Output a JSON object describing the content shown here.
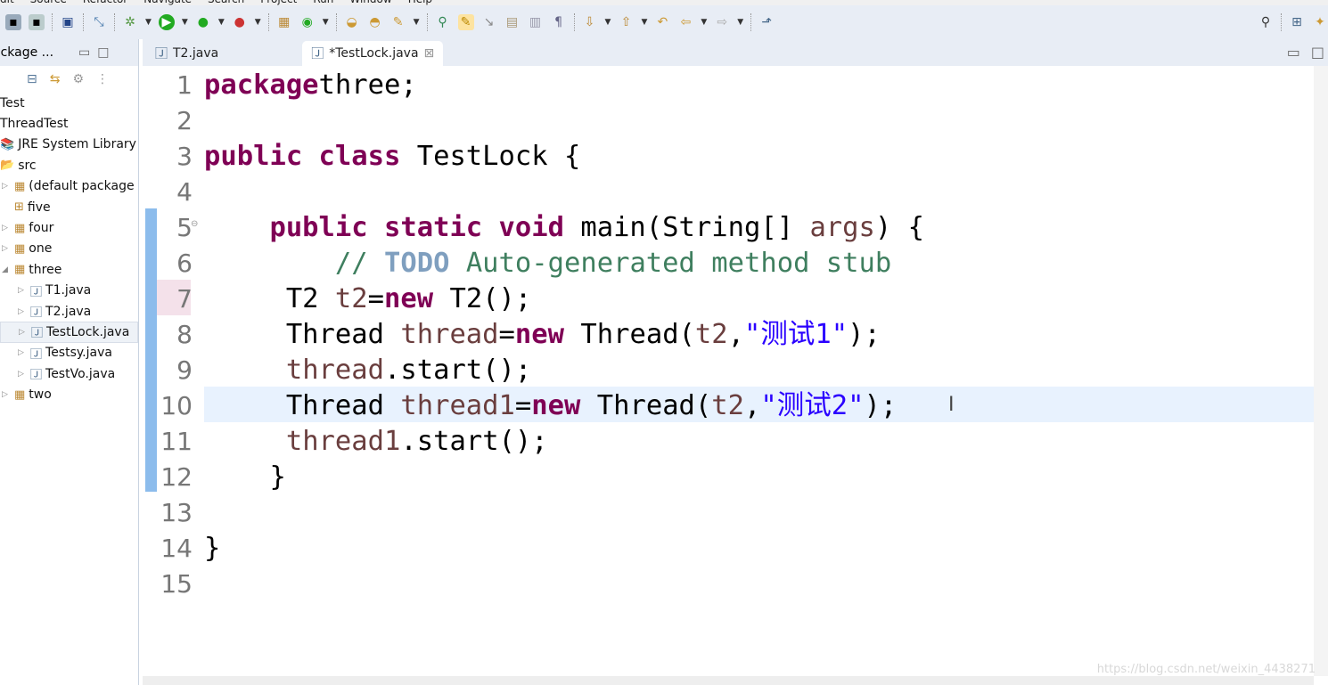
{
  "menu": [
    "dit",
    "Source",
    "Refactor",
    "Navigate",
    "Search",
    "Project",
    "Run",
    "Window",
    "Help"
  ],
  "left_panel": {
    "title": "ackage ...",
    "items": [
      {
        "label": "Test"
      },
      {
        "label": "ThreadTest"
      },
      {
        "label": "JRE System Library"
      },
      {
        "label": "src"
      },
      {
        "label": "(default package"
      },
      {
        "label": "five"
      },
      {
        "label": "four"
      },
      {
        "label": "one"
      },
      {
        "label": "three"
      },
      {
        "label": "T1.java"
      },
      {
        "label": "T2.java"
      },
      {
        "label": "TestLock.java"
      },
      {
        "label": "Testsy.java"
      },
      {
        "label": "TestVo.java"
      },
      {
        "label": "two"
      }
    ]
  },
  "tabs": [
    {
      "label": "T2.java"
    },
    {
      "label": "*TestLock.java"
    }
  ],
  "editor": {
    "line_numbers": [
      "1",
      "2",
      "3",
      "4",
      "5",
      "6",
      "7",
      "8",
      "9",
      "10",
      "11",
      "12",
      "13",
      "14",
      "15"
    ],
    "lines": [
      [
        [
          "kw",
          "package"
        ],
        [
          "",
          "three;"
        ]
      ],
      [],
      [
        [
          "kw",
          "public class"
        ],
        [
          "",
          " TestLock {"
        ]
      ],
      [],
      [
        [
          "",
          "    "
        ],
        [
          "kw",
          "public static void"
        ],
        [
          "",
          " main(String[] "
        ],
        [
          "var",
          "args"
        ],
        [
          "",
          ") {"
        ]
      ],
      [
        [
          "cm",
          "        // "
        ],
        [
          "todo",
          "TODO"
        ],
        [
          "cm",
          " Auto-generated method stub"
        ]
      ],
      [
        [
          "",
          "     T2 "
        ],
        [
          "var",
          "t2"
        ],
        [
          "",
          "="
        ],
        [
          "kw",
          "new"
        ],
        [
          "",
          " T2();"
        ]
      ],
      [
        [
          "",
          "     Thread "
        ],
        [
          "var",
          "thread"
        ],
        [
          "",
          "="
        ],
        [
          "kw",
          "new"
        ],
        [
          "",
          " Thread("
        ],
        [
          "var",
          "t2"
        ],
        [
          "",
          ","
        ],
        [
          "str",
          "\"测试1\""
        ],
        [
          "",
          ");"
        ]
      ],
      [
        [
          "",
          "     "
        ],
        [
          "var",
          "thread"
        ],
        [
          "",
          ".start();"
        ]
      ],
      [
        [
          "",
          "     Thread "
        ],
        [
          "var",
          "thread1"
        ],
        [
          "",
          "="
        ],
        [
          "kw",
          "new"
        ],
        [
          "",
          " Thread("
        ],
        [
          "var",
          "t2"
        ],
        [
          "",
          ","
        ],
        [
          "str",
          "\"测试2\""
        ],
        [
          "",
          ");"
        ]
      ],
      [
        [
          "",
          "     "
        ],
        [
          "var",
          "thread1"
        ],
        [
          "",
          ".start();"
        ]
      ],
      [
        [
          "",
          "    }"
        ]
      ],
      [],
      [
        [
          "",
          "}"
        ]
      ],
      []
    ]
  },
  "watermark": "https://blog.csdn.net/weixin_4438271"
}
